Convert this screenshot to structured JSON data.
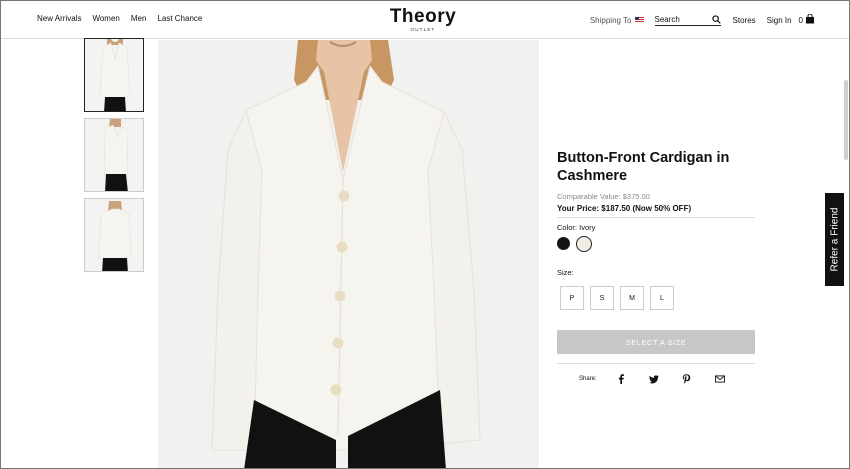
{
  "nav": {
    "items": [
      "New Arrivals",
      "Women",
      "Men",
      "Last Chance"
    ]
  },
  "logo": {
    "main": "Theory",
    "sub": "OUTLET"
  },
  "utility": {
    "shipping_label": "Shipping To",
    "search_label": "Search",
    "stores_label": "Stores",
    "signin_label": "Sign In",
    "bag_count": "0"
  },
  "product": {
    "title": "Button-Front Cardigan in Cashmere",
    "comparable_value": "Comparable Value: $375.00",
    "your_price": "Your Price: $187.50 (Now 50% OFF)",
    "color_label": "Color:",
    "color_value": "Ivory",
    "colors": [
      {
        "name": "Black",
        "hex": "#151515"
      },
      {
        "name": "Ivory",
        "hex": "#f1ede4"
      }
    ],
    "size_label": "Size:",
    "sizes": [
      "P",
      "S",
      "M",
      "L"
    ],
    "cta_label": "SELECT A SIZE",
    "share_label": "Share:",
    "share_icons": [
      "facebook-icon",
      "twitter-icon",
      "pinterest-icon",
      "email-icon"
    ]
  },
  "refer": {
    "label": "Refer a Friend"
  },
  "colors": {
    "accent": "#111111",
    "cta_disabled": "#c7c7c7",
    "garment": "#f5f3ee"
  }
}
